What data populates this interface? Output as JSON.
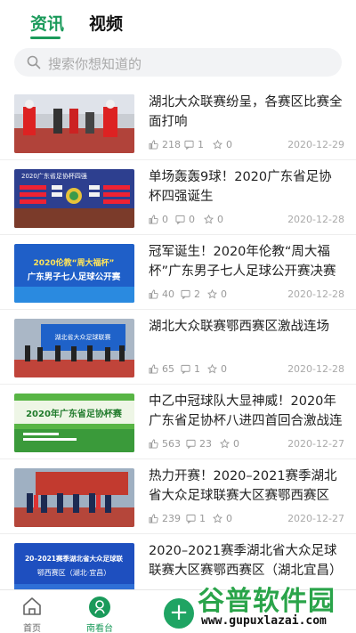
{
  "tabs": [
    {
      "label": "资讯",
      "active": true
    },
    {
      "label": "视频",
      "active": false
    }
  ],
  "search": {
    "placeholder": "搜索你想知道的",
    "icon": "search-icon"
  },
  "articles": [
    {
      "title": "湖北大众联赛纷呈，各赛区比赛全面打响",
      "likes": "218",
      "comments": "1",
      "favs": "0",
      "date": "2020-12-29"
    },
    {
      "title": "单场轰轰9球！2020广东省足协杯四强诞生",
      "likes": "0",
      "comments": "0",
      "favs": "0",
      "date": "2020-12-28"
    },
    {
      "title": "冠军诞生！2020年伦教“周大福杯”广东男子七人足球公开赛决赛日战报",
      "likes": "40",
      "comments": "2",
      "favs": "0",
      "date": "2020-12-28"
    },
    {
      "title": "湖北大众联赛鄂西赛区激战连场",
      "likes": "65",
      "comments": "1",
      "favs": "0",
      "date": "2020-12-28"
    },
    {
      "title": "中乙中冠球队大显神威！2020年广东省足协杯八进四首回合激战连场",
      "likes": "563",
      "comments": "23",
      "favs": "0",
      "date": "2020-12-27"
    },
    {
      "title": "热力开赛！2020–2021赛季湖北省大众足球联赛大区赛鄂西赛区（湖北宜昌）",
      "likes": "239",
      "comments": "1",
      "favs": "0",
      "date": "2020-12-27"
    },
    {
      "title": "2020–2021赛季湖北省大众足球联赛大区赛鄂西赛区（湖北宜昌）即将开战",
      "likes": "",
      "comments": "",
      "favs": "",
      "date": ""
    }
  ],
  "thumb_texts": {
    "t2": "2020广东省足协杯四强",
    "t3a": "2020伦教“周大福杯”",
    "t3b": "广东男子七人足球公开赛",
    "t4": "湖北省大众足球联赛",
    "t5": "2020年广东省足协杯赛",
    "t7a": "20–2021赛季湖北省大众足球联",
    "t7b": "鄂西赛区（湖北·宜昌）"
  },
  "bottom_nav": [
    {
      "label": "首页",
      "icon": "home-icon"
    },
    {
      "label": "南看台",
      "icon": "stand-icon",
      "active": true
    }
  ],
  "add_button": {
    "label": "+"
  },
  "watermark": {
    "main": "谷普软件园",
    "url": "www.gupuxlazai.com"
  },
  "colors": {
    "accent": "#1a9a5a",
    "muted": "#999999"
  }
}
